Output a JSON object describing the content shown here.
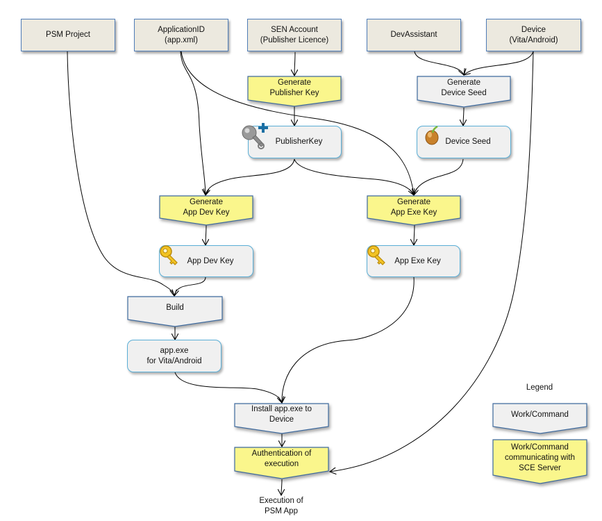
{
  "diagram": {
    "sources": {
      "psm_project": "PSM Project",
      "application_id": "ApplicationID\n(app.xml)",
      "sen_account": "SEN Account\n(Publisher Licence)",
      "dev_assistant": "DevAssistant",
      "device": "Device\n(Vita/Android)"
    },
    "commands": {
      "generate_publisher_key": "Generate\nPublisher Key",
      "generate_device_seed": "Generate\nDevice Seed",
      "generate_app_dev_key": "Generate\nApp Dev Key",
      "generate_app_exe_key": "Generate\nApp Exe Key",
      "build": "Build",
      "install": "Install app.exe to\nDevice",
      "authentication": "Authentication of\nexecution"
    },
    "artifacts": {
      "publisher_key": "PublisherKey",
      "device_seed": "Device Seed",
      "app_dev_key": "App Dev Key",
      "app_exe_key": "App Exe Key",
      "app_exe": "app.exe\nfor Vita/Android"
    },
    "result": "Execution of\nPSM App",
    "legend": {
      "title": "Legend",
      "work_command": "Work/Command",
      "work_command_sce": "Work/Command\ncommunicating  with\nSCE Server"
    },
    "icons": {
      "publisher_key": "key-add-icon",
      "device_seed": "seed-icon",
      "app_dev_key": "gold-key-icon",
      "app_exe_key": "gold-key-icon"
    },
    "colors": {
      "source_fill": "#ECE9DF",
      "source_border": "#4F7DB8",
      "command_fill": "#F0F0F0",
      "command_border": "#3E6A9E",
      "sce_command_fill": "#FAF68C",
      "artifact_fill": "#F0F0F0",
      "artifact_border": "#5AAED6"
    }
  }
}
